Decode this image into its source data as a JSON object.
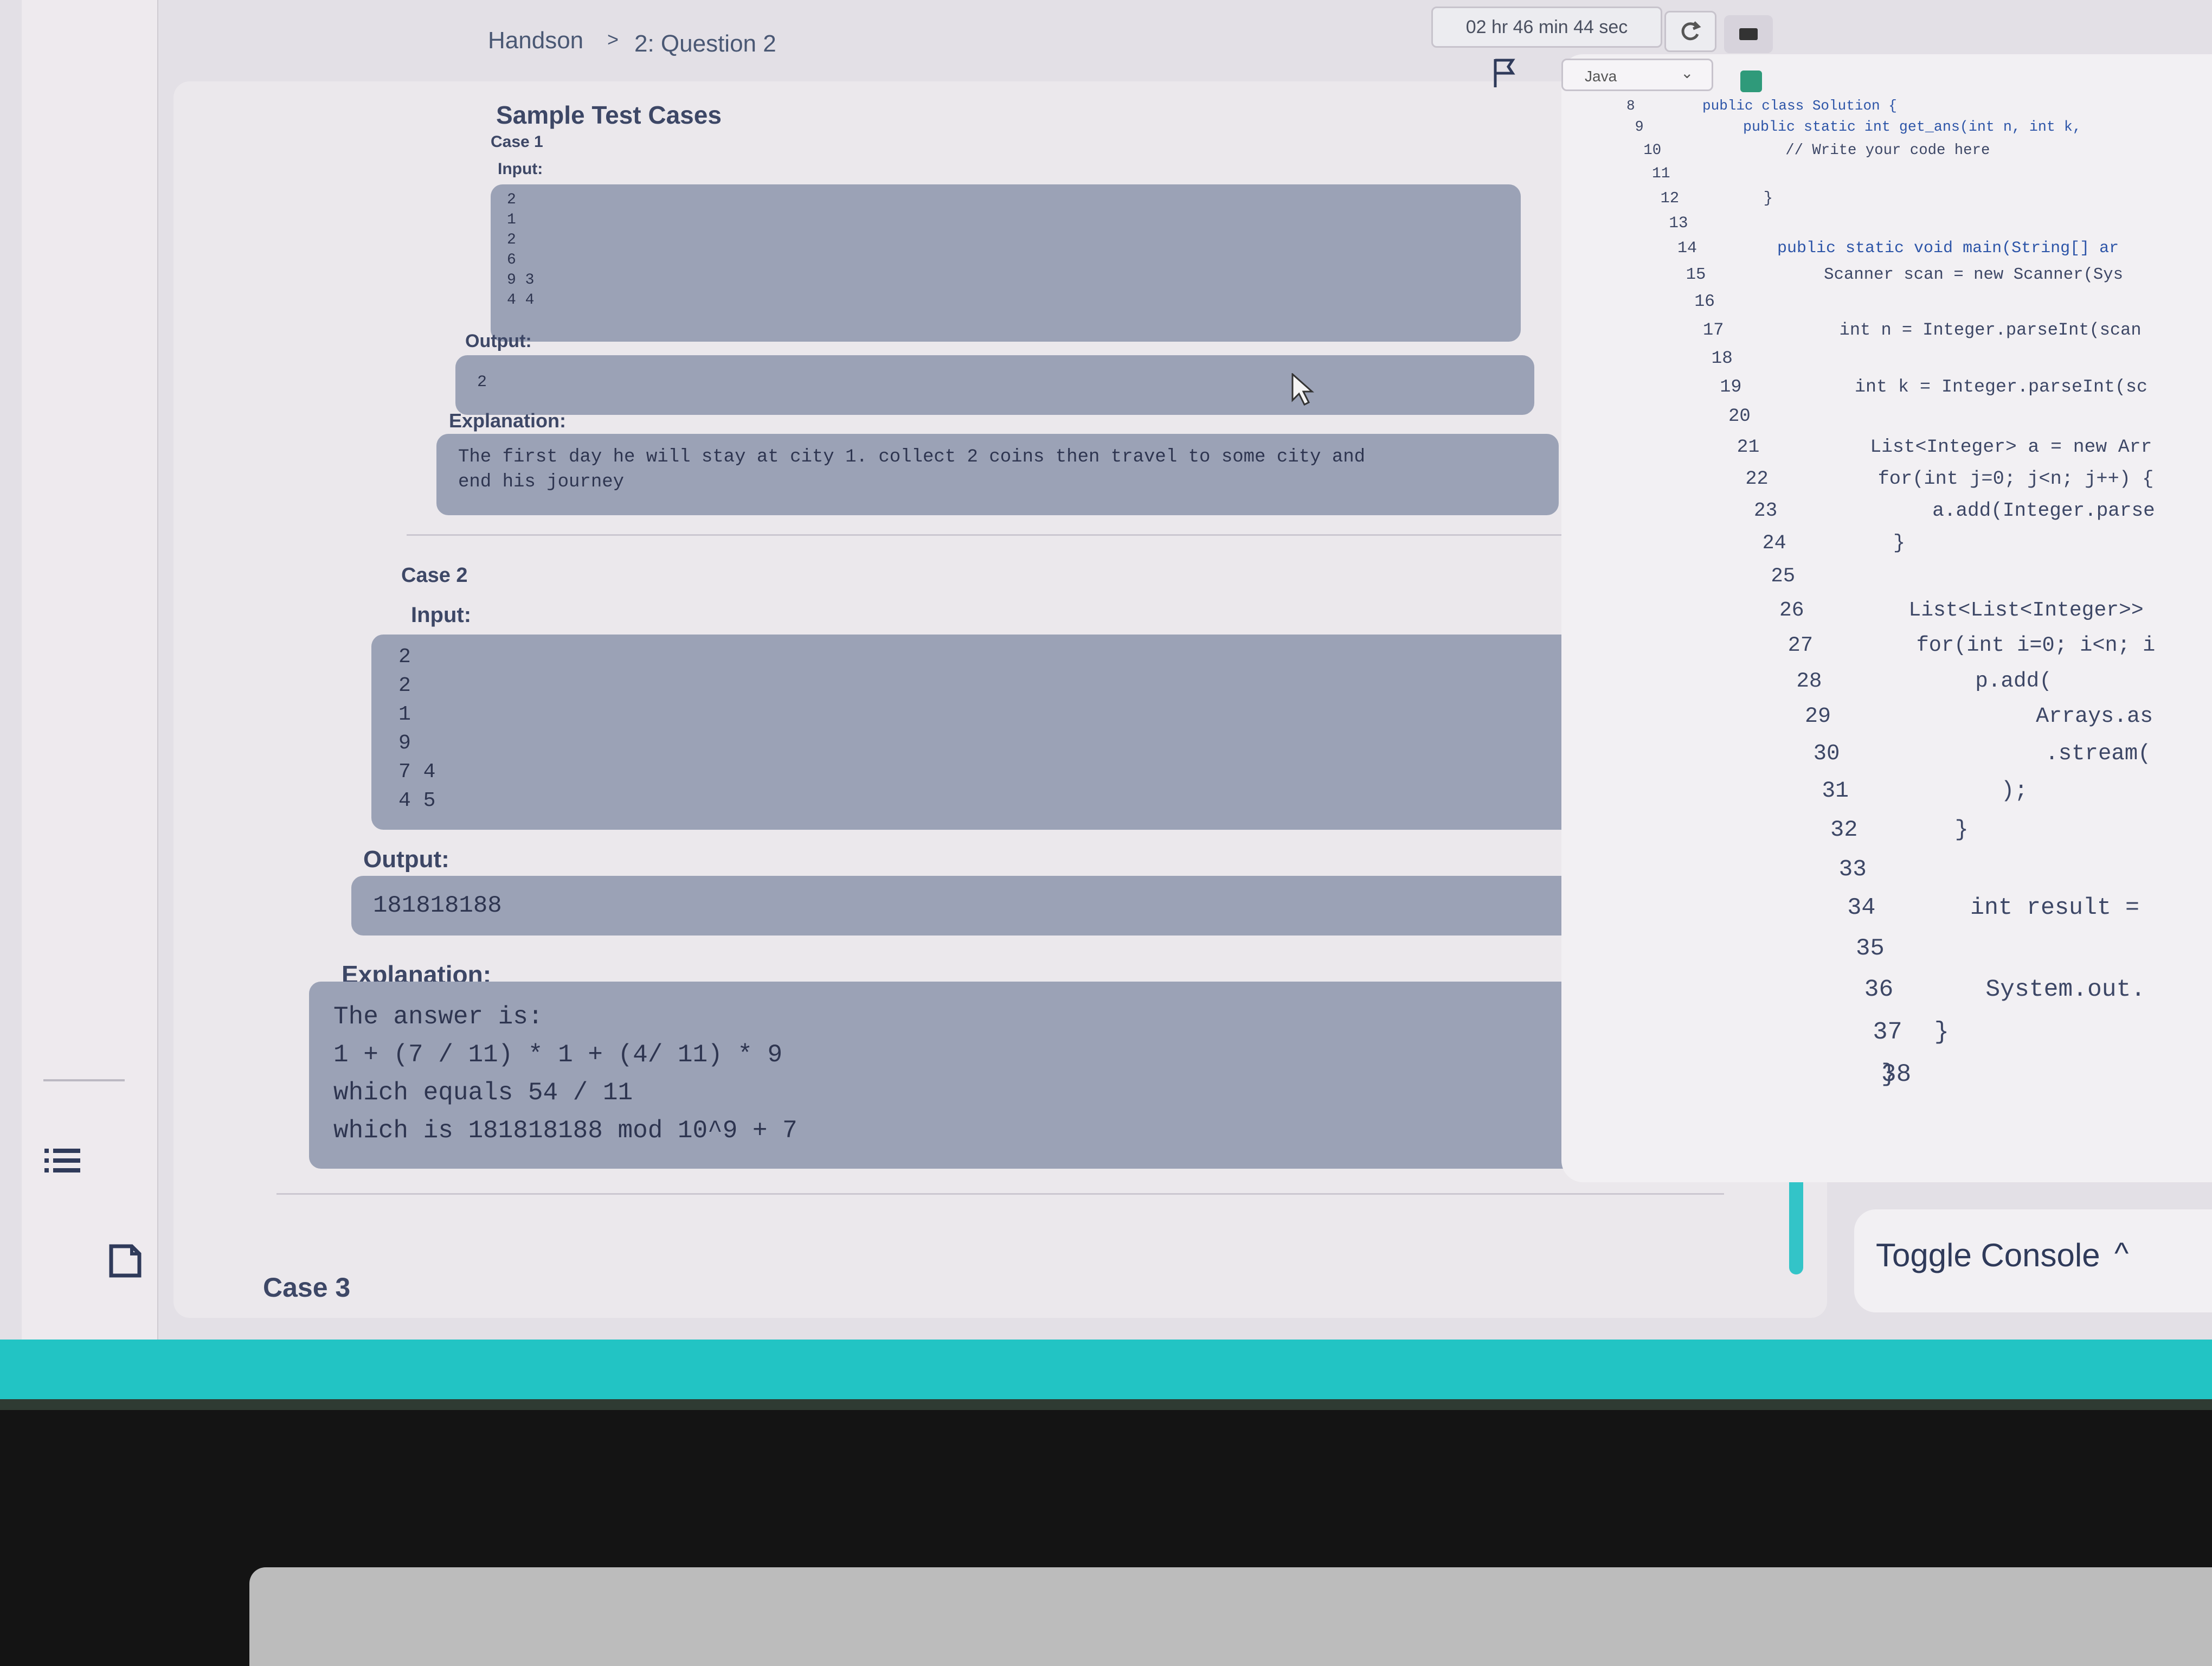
{
  "breadcrumb": {
    "root": "Handson",
    "separator": ">",
    "current": "2: Question 2"
  },
  "timer": "02 hr 46 min 44 sec",
  "editor": {
    "language": "Java",
    "lines": [
      {
        "n": "8",
        "code": "public class Solution {"
      },
      {
        "n": "9",
        "code": "    public static int get_ans(int n, int k,"
      },
      {
        "n": "10",
        "code": "        // Write your code here"
      },
      {
        "n": "11",
        "code": ""
      },
      {
        "n": "12",
        "code": "    }"
      },
      {
        "n": "13",
        "code": ""
      },
      {
        "n": "14",
        "code": "    public static void main(String[] ar"
      },
      {
        "n": "15",
        "code": "        Scanner scan = new Scanner(Sys"
      },
      {
        "n": "16",
        "code": ""
      },
      {
        "n": "17",
        "code": "        int n = Integer.parseInt(scan"
      },
      {
        "n": "18",
        "code": ""
      },
      {
        "n": "19",
        "code": "        int k = Integer.parseInt(sc"
      },
      {
        "n": "20",
        "code": ""
      },
      {
        "n": "21",
        "code": "        List<Integer> a = new Arr"
      },
      {
        "n": "22",
        "code": "        for(int j=0; j<n; j++) {"
      },
      {
        "n": "23",
        "code": "            a.add(Integer.parse"
      },
      {
        "n": "24",
        "code": "        }"
      },
      {
        "n": "25",
        "code": ""
      },
      {
        "n": "26",
        "code": "        List<List<Integer>>"
      },
      {
        "n": "27",
        "code": "        for(int i=0; i<n; i"
      },
      {
        "n": "28",
        "code": "            p.add("
      },
      {
        "n": "29",
        "code": "                Arrays.as"
      },
      {
        "n": "30",
        "code": "                .stream("
      },
      {
        "n": "31",
        "code": "            );"
      },
      {
        "n": "32",
        "code": "        }"
      },
      {
        "n": "33",
        "code": ""
      },
      {
        "n": "34",
        "code": "        int result ="
      },
      {
        "n": "35",
        "code": ""
      },
      {
        "n": "36",
        "code": "        System.out."
      },
      {
        "n": "37",
        "code": "    }"
      },
      {
        "n": "38",
        "code": "}"
      }
    ]
  },
  "problem": {
    "heading": "Sample Test Cases",
    "labels": {
      "input": "Input:",
      "output": "Output:",
      "explanation": "Explanation:"
    },
    "case1": {
      "title": "Case 1",
      "input": "2\n1\n2\n6\n9 3\n4 4",
      "output": "2",
      "explanation": "The first day he will stay at city 1. collect 2 coins then travel to some city and\nend his journey"
    },
    "case2": {
      "title": "Case 2",
      "input": "2\n2\n1\n9\n7 4\n4 5",
      "output": "181818188",
      "explanation": "The answer is:\n1 + (7 / 11) * 1 + (4/ 11) * 9\nwhich equals 54 / 11\nwhich is 181818188 mod 10^9 + 7"
    },
    "case3": {
      "title": "Case 3"
    }
  },
  "console": {
    "label": "Toggle Console",
    "chevron": "^"
  },
  "colors": {
    "accent": "#22c4c4",
    "block": "#9ba2b6",
    "text": "#3d4766"
  }
}
